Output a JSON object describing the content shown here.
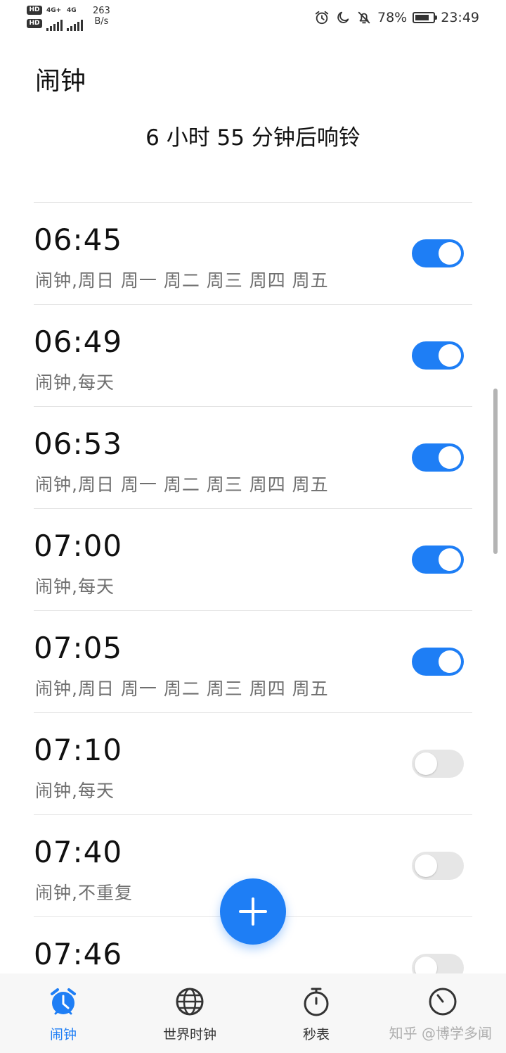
{
  "status_bar": {
    "hd1": "HD",
    "hd2": "HD",
    "net1": "4G+",
    "net2": "4G",
    "speed_value": "263",
    "speed_unit": "B/s",
    "battery": "78%",
    "battery_level": 0.78,
    "time": "23:49",
    "icons": [
      "alarm-clock-icon",
      "moon-icon",
      "bell-off-icon",
      "battery-icon"
    ]
  },
  "header": {
    "title": "闹钟",
    "countdown": "6 小时 55 分钟后响铃"
  },
  "alarms": [
    {
      "time": "06:45",
      "label": "闹钟,周日 周一 周二 周三 周四 周五",
      "enabled": true
    },
    {
      "time": "06:49",
      "label": "闹钟,每天",
      "enabled": true
    },
    {
      "time": "06:53",
      "label": "闹钟,周日 周一 周二 周三 周四 周五",
      "enabled": true
    },
    {
      "time": "07:00",
      "label": "闹钟,每天",
      "enabled": true
    },
    {
      "time": "07:05",
      "label": "闹钟,周日 周一 周二 周三 周四 周五",
      "enabled": true
    },
    {
      "time": "07:10",
      "label": "闹钟,每天",
      "enabled": false
    },
    {
      "time": "07:40",
      "label": "闹钟,不重复",
      "enabled": false
    },
    {
      "time": "07:46",
      "label": "",
      "enabled": false
    }
  ],
  "fab": {
    "icon": "plus-icon"
  },
  "bottom_nav": [
    {
      "label": "闹钟",
      "icon": "alarm-clock-icon",
      "active": true
    },
    {
      "label": "世界时钟",
      "icon": "globe-icon",
      "active": false
    },
    {
      "label": "秒表",
      "icon": "stopwatch-icon",
      "active": false
    },
    {
      "label": "",
      "icon": "timer-icon",
      "active": false
    }
  ],
  "watermark": "知乎 @博学多闻",
  "colors": {
    "accent": "#1e7ef5",
    "toggle_off": "#e6e6e6",
    "nav_bg": "#f7f7f7"
  }
}
